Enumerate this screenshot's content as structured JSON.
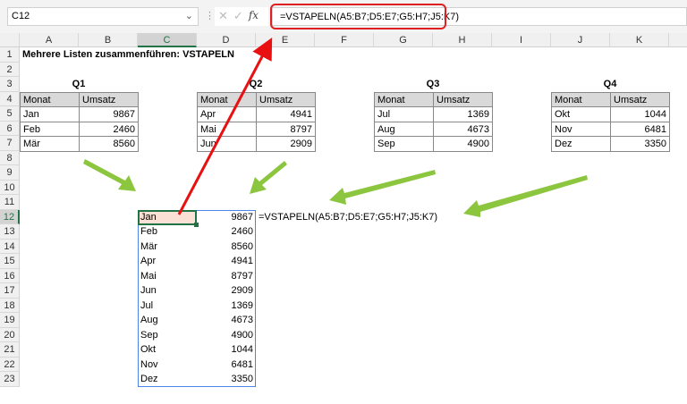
{
  "formula_bar": {
    "name_box": "C12",
    "formula": "=VSTAPELN(A5:B7;D5:E7;G5:H7;J5:K7)",
    "fx": "fx",
    "cancel": "✕",
    "enter": "✓"
  },
  "columns": [
    "A",
    "B",
    "C",
    "D",
    "E",
    "F",
    "G",
    "H",
    "I",
    "J",
    "K"
  ],
  "rows": [
    "1",
    "2",
    "3",
    "4",
    "5",
    "6",
    "7",
    "8",
    "9",
    "10",
    "11",
    "12",
    "13",
    "14",
    "15",
    "16",
    "17",
    "18",
    "19",
    "20",
    "21",
    "22",
    "23"
  ],
  "title": "Mehrere Listen zusammenführen: VSTAPELN",
  "tables": [
    {
      "label": "Q1",
      "headers": [
        "Monat",
        "Umsatz"
      ],
      "rows": [
        [
          "Jan",
          "9867"
        ],
        [
          "Feb",
          "2460"
        ],
        [
          "Mär",
          "8560"
        ]
      ]
    },
    {
      "label": "Q2",
      "headers": [
        "Monat",
        "Umsatz"
      ],
      "rows": [
        [
          "Apr",
          "4941"
        ],
        [
          "Mai",
          "8797"
        ],
        [
          "Jun",
          "2909"
        ]
      ]
    },
    {
      "label": "Q3",
      "headers": [
        "Monat",
        "Umsatz"
      ],
      "rows": [
        [
          "Jul",
          "1369"
        ],
        [
          "Aug",
          "4673"
        ],
        [
          "Sep",
          "4900"
        ]
      ]
    },
    {
      "label": "Q4",
      "headers": [
        "Monat",
        "Umsatz"
      ],
      "rows": [
        [
          "Okt",
          "1044"
        ],
        [
          "Nov",
          "6481"
        ],
        [
          "Dez",
          "3350"
        ]
      ]
    }
  ],
  "result": [
    [
      "Jan",
      "9867"
    ],
    [
      "Feb",
      "2460"
    ],
    [
      "Mär",
      "8560"
    ],
    [
      "Apr",
      "4941"
    ],
    [
      "Mai",
      "8797"
    ],
    [
      "Jun",
      "2909"
    ],
    [
      "Jul",
      "1369"
    ],
    [
      "Aug",
      "4673"
    ],
    [
      "Sep",
      "4900"
    ],
    [
      "Okt",
      "1044"
    ],
    [
      "Nov",
      "6481"
    ],
    [
      "Dez",
      "3350"
    ]
  ],
  "formula_text": "=VSTAPELN(A5:B7;D5:E7;G5:H7;J5:K7)",
  "colors": {
    "arrow_red": "#e81010",
    "arrow_green": "#8cc63f",
    "selection": "#217346"
  }
}
